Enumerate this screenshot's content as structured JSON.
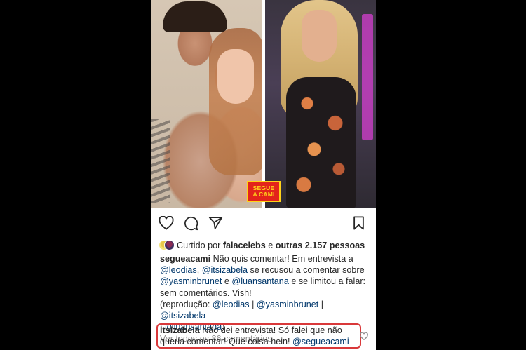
{
  "post": {
    "image": {
      "watermark_line1": "SEGUE",
      "watermark_line2": "A CAMI"
    },
    "actions": {
      "like_icon": "heart-icon",
      "comment_icon": "comment-bubble-icon",
      "share_icon": "paper-plane-icon",
      "save_icon": "bookmark-icon"
    },
    "likes": {
      "prefix": "Curtido por",
      "user": "falacelebs",
      "conj": "e",
      "others": "outras 2.157 pessoas"
    },
    "caption": {
      "author": "segueacami",
      "text1": "Não quis comentar! Em entrevista a",
      "mention_leodias": "@leodias",
      "sep1": ",",
      "mention_itsizabela": "@itsizabela",
      "text2": "se recusou a comentar sobre",
      "mention_yasminbrunet": "@yasminbrunet",
      "text3": "e",
      "mention_luansantana": "@luansantana",
      "text4": "e se limitou a falar:",
      "text5": "sem comentários. Vish!",
      "credit_open": "(reprodução:",
      "credit_1": "@leodias",
      "pipe": "|",
      "credit_2": "@yasminbrunet",
      "credit_3": "@itsizabela",
      "credit_4": "@luansantana",
      "credit_close": ")"
    },
    "view_all_comments": "Ver todos os 86 comentários",
    "highlighted_comment": {
      "author": "itsizabela",
      "text": "Não dei entrevista! Só falei que não queria comentar! Que coisa hein!",
      "mention": "@segueacami"
    },
    "colors": {
      "highlight_border": "#d9383a",
      "mention": "#00376b",
      "muted": "#8e8e8e",
      "watermark_bg": "#e3241b",
      "watermark_fg": "#ffd21a"
    }
  }
}
